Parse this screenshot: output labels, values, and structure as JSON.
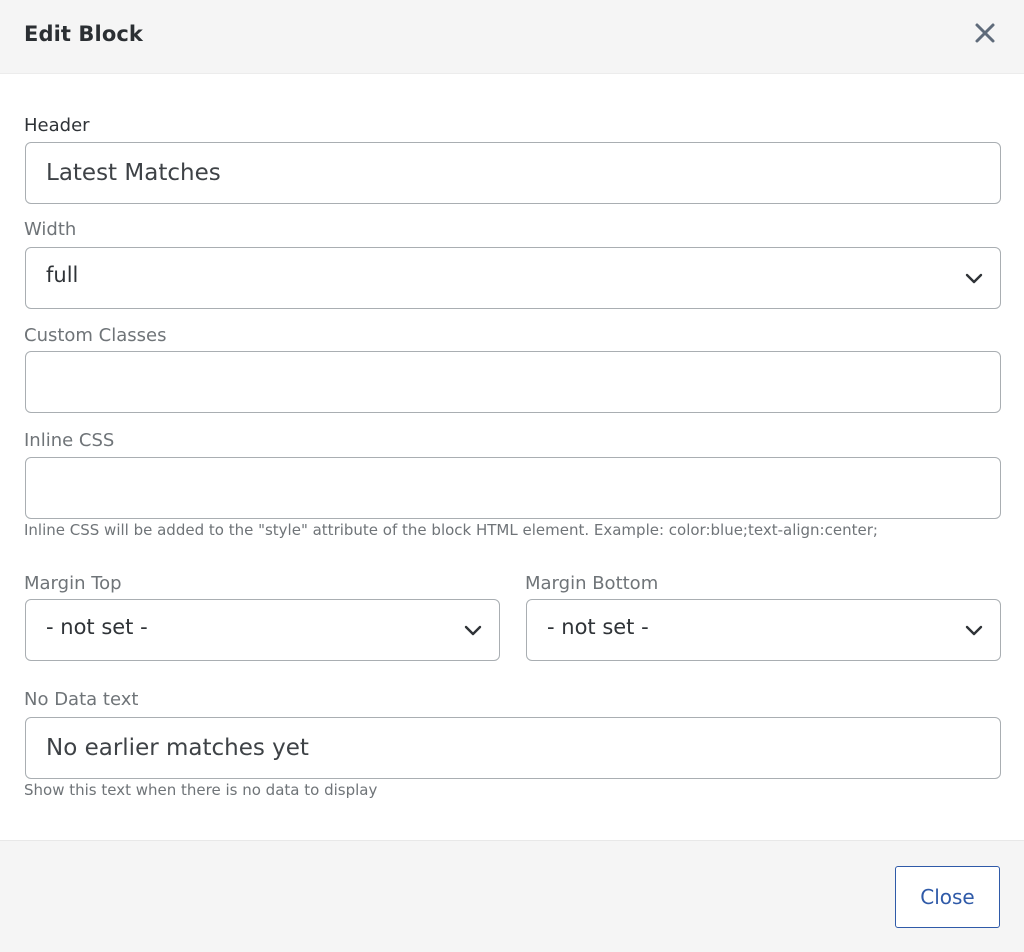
{
  "modal": {
    "title": "Edit Block"
  },
  "fields": {
    "header": {
      "label": "Header",
      "value": "Latest Matches"
    },
    "width": {
      "label": "Width",
      "value": "full"
    },
    "custom_classes": {
      "label": "Custom Classes",
      "value": ""
    },
    "inline_css": {
      "label": "Inline CSS",
      "value": "",
      "help": "Inline CSS will be added to the \"style\" attribute of the block HTML element. Example: color:blue;text-align:center;"
    },
    "margin_top": {
      "label": "Margin Top",
      "value": "- not set -"
    },
    "margin_bottom": {
      "label": "Margin Bottom",
      "value": "- not set -"
    },
    "no_data_text": {
      "label": "No Data text",
      "value": "No earlier matches yet",
      "help": "Show this text when there is no data to display"
    }
  },
  "footer": {
    "close_label": "Close"
  },
  "icons": {
    "close": "close-icon",
    "chevron": "chevron-down-icon"
  },
  "colors": {
    "accent": "#2f5aa8",
    "header_bg": "#f5f5f5",
    "border": "#a9aeb2"
  }
}
